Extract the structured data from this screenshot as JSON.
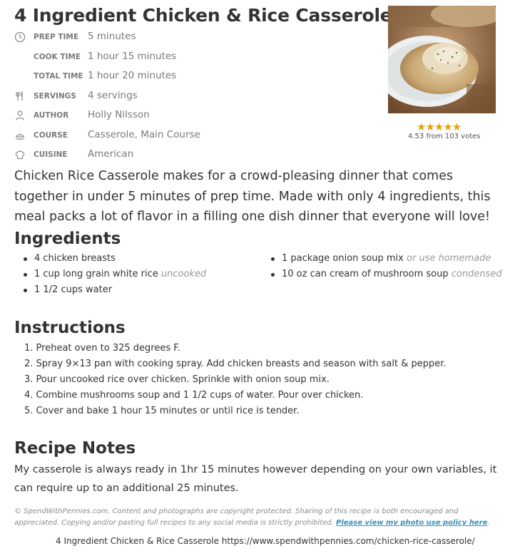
{
  "recipe": {
    "title": "4 Ingredient Chicken & Rice Casserole",
    "meta": [
      {
        "icon": "clock-icon",
        "label": "PREP TIME",
        "value": "5 minutes"
      },
      {
        "icon": "",
        "label": "COOK TIME",
        "value": "1 hour 15 minutes"
      },
      {
        "icon": "",
        "label": "TOTAL TIME",
        "value": "1 hour 20 minutes"
      },
      {
        "icon": "utensils-icon",
        "label": "SERVINGS",
        "value": "4 servings"
      },
      {
        "icon": "person-icon",
        "label": "AUTHOR",
        "value": "Holly Nilsson"
      },
      {
        "icon": "dish-icon",
        "label": "COURSE",
        "value": "Casserole, Main Course"
      },
      {
        "icon": "chef-hat-icon",
        "label": "CUISINE",
        "value": "American"
      }
    ],
    "rating": {
      "stars": "★★★★★",
      "value": 4.53,
      "text": "4.53 from 103 votes",
      "color": "#e5a00d"
    },
    "summary": "Chicken Rice Casserole makes for a crowd-pleasing dinner that comes together in under 5 minutes of prep time. Made with only 4 ingredients, this meal packs a lot of flavor in a filling one dish dinner that everyone will love!"
  },
  "ingredients": {
    "heading": "Ingredients",
    "left": [
      {
        "text": "4 chicken breasts",
        "note": ""
      },
      {
        "text": "1 cup long grain white rice",
        "note": "uncooked"
      },
      {
        "text": "1 1/2 cups water",
        "note": ""
      }
    ],
    "right": [
      {
        "text": "1 package onion soup mix",
        "note": "or use homemade"
      },
      {
        "text": "10 oz can cream of mushroom soup",
        "note": "condensed"
      }
    ]
  },
  "instructions": {
    "heading": "Instructions",
    "steps": [
      "1. Preheat oven to 325 degrees F.",
      "2. Spray 9×13 pan with cooking spray. Add chicken breasts and season with salt & pepper.",
      "3. Pour uncooked rice over chicken. Sprinkle with onion soup mix.",
      "4. Combine mushrooms soup and 1 1/2 cups of water. Pour over chicken.",
      "5. Cover and bake 1 hour 15 minutes or until rice is tender."
    ]
  },
  "notes": {
    "heading": "Recipe Notes",
    "text": "My casserole is always ready in 1hr 15 minutes however depending on your own variables, it can require up to an additional 25 minutes."
  },
  "copyright": {
    "text": "© SpendWithPennies.com. Content and photographs are copyright protected. Sharing of this recipe is both encouraged and appreciated. Copying and/or pasting full recipes to any social media is strictly prohibited. ",
    "link": "Please view my photo use policy here",
    "end": "."
  },
  "footer": {
    "url": "4 Ingredient Chicken & Rice Casserole https://www.spendwithpennies.com/chicken-rice-casserole/"
  },
  "colors": {
    "accent_link": "#3a8fb5",
    "meta_gray": "#7a7a7a",
    "text": "#333333"
  }
}
